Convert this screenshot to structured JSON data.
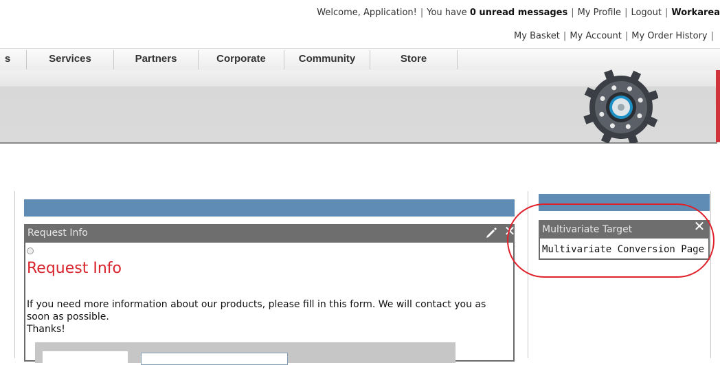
{
  "topbar": {
    "welcome": "Welcome, Application!",
    "messages_prefix": "You have",
    "messages_bold": "0 unread messages",
    "my_profile": "My Profile",
    "logout": "Logout",
    "workarea": "Workarea"
  },
  "secondary": {
    "basket": "My Basket",
    "account": "My Account",
    "order_history": "My Order History"
  },
  "nav": {
    "items": [
      "s",
      "Services",
      "Partners",
      "Corporate",
      "Community",
      "Store"
    ]
  },
  "request_widget": {
    "title": "Request Info",
    "heading": "Request Info",
    "body": "If you need more information about our products, please fill in this form. We will contact you as soon as possible.",
    "thanks": "Thanks!"
  },
  "mv_widget": {
    "title": "Multivariate Target",
    "link": "Multivariate Conversion Page"
  },
  "colors": {
    "header_blue": "#5f8cb5",
    "widget_title_gray": "#6e6e6e",
    "heading_red": "#d9232c",
    "highlight_red": "#e0202a"
  }
}
